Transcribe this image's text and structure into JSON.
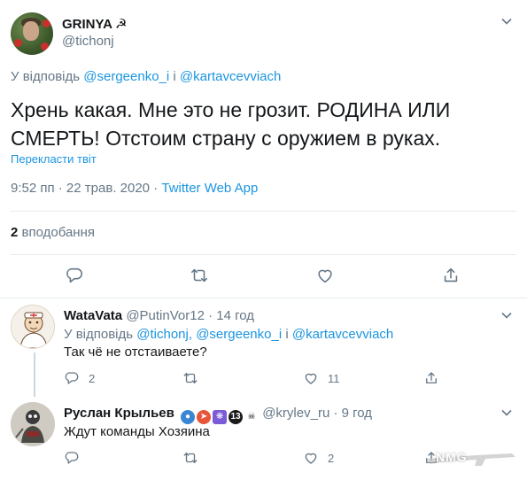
{
  "main_tweet": {
    "name": "GRINYA",
    "name_symbol": "☭",
    "handle": "@tichonj",
    "reply_prefix": "У відповідь",
    "reply_user1": "@sergeenko_i",
    "reply_and": "і",
    "reply_user2": "@kartavcevviach",
    "text_line1": "Хрень какая. Мне это не грозит. РОДИНА ИЛИ",
    "text_line2": "СМЕРТЬ! Отстоим страну с оружием в руках.",
    "translate": "Перекласти твіт",
    "time": "9:52 пп · 22 трав. 2020 · ",
    "source": "Twitter Web App",
    "likes_count": "2",
    "likes_label": "вподобання"
  },
  "reply1": {
    "name": "WataVata",
    "handle": "@PutinVor12",
    "age": "· 14 год",
    "reply_prefix": "У відповідь",
    "reply_user1": "@tichonj",
    "reply_user2": "@sergeenko_i",
    "reply_and": "і",
    "reply_user3": "@kartavcevviach",
    "text": "Так чё не отстаиваете?",
    "replies_count": "2",
    "likes_count": "11"
  },
  "reply2": {
    "name": "Руслан Крыльев",
    "badge_13": "13",
    "handle": "@krylev_ru",
    "age": "· 9 год",
    "text": "Ждут команды Хозяина",
    "likes_count": "2"
  },
  "watermark": "NMG",
  "colors": {
    "accent": "#1b95e0",
    "secondary": "#657786",
    "divider": "#e6ecf0"
  }
}
